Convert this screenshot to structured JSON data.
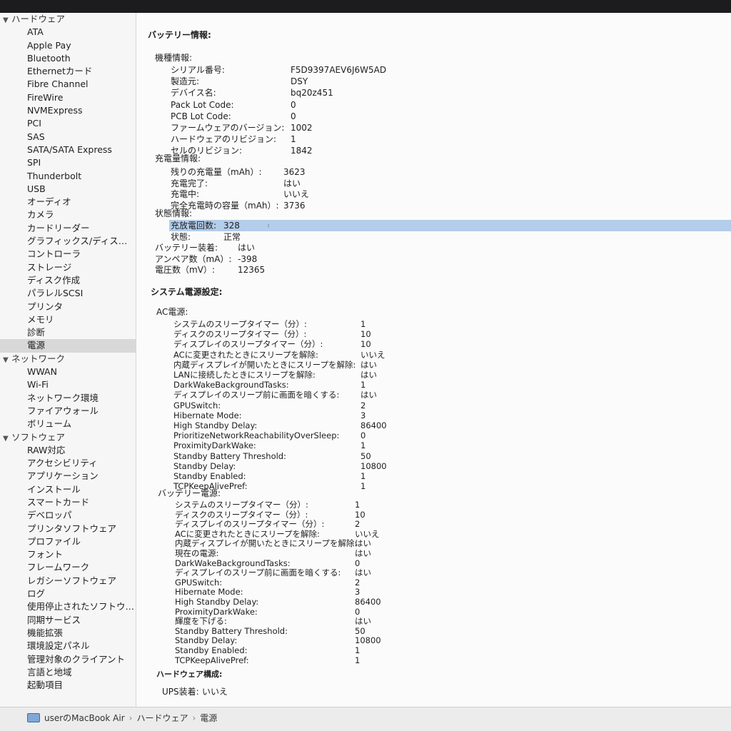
{
  "sidebar": {
    "groups": [
      {
        "label": "ハードウェア",
        "items": [
          "ATA",
          "Apple Pay",
          "Bluetooth",
          "Ethernetカード",
          "Fibre Channel",
          "FireWire",
          "NVMExpress",
          "PCI",
          "SAS",
          "SATA/SATA Express",
          "SPI",
          "Thunderbolt",
          "USB",
          "オーディオ",
          "カメラ",
          "カードリーダー",
          "グラフィックス/ディス…",
          "コントローラ",
          "ストレージ",
          "ディスク作成",
          "パラレルSCSI",
          "プリンタ",
          "メモリ",
          "診断",
          "電源"
        ],
        "selected": 24
      },
      {
        "label": "ネットワーク",
        "items": [
          "WWAN",
          "Wi-Fi",
          "ネットワーク環境",
          "ファイアウォール",
          "ボリューム"
        ]
      },
      {
        "label": "ソフトウェア",
        "items": [
          "RAW対応",
          "アクセシビリティ",
          "アプリケーション",
          "インストール",
          "スマートカード",
          "デベロッパ",
          "プリンタソフトウェア",
          "プロファイル",
          "フォント",
          "フレームワーク",
          "レガシーソフトウェア",
          "ログ",
          "使用停止されたソフトウ…",
          "同期サービス",
          "機能拡張",
          "環境設定パネル",
          "管理対象のクライアント",
          "言語と地域",
          "起動項目"
        ]
      }
    ]
  },
  "content": {
    "battery_title": "バッテリー情報:",
    "model_title": "機種情報:",
    "model": [
      {
        "k": "シリアル番号:",
        "v": "F5D9397AEV6J6W5AD"
      },
      {
        "k": "製造元:",
        "v": "DSY"
      },
      {
        "k": "デバイス名:",
        "v": "bq20z451"
      },
      {
        "k": "Pack Lot Code:",
        "v": "0"
      },
      {
        "k": "PCB Lot Code:",
        "v": "0"
      },
      {
        "k": "ファームウェアのバージョン:",
        "v": "1002"
      },
      {
        "k": "ハードウェアのリビジョン:",
        "v": "1"
      },
      {
        "k": "セルのリビジョン:",
        "v": "1842"
      }
    ],
    "charge_title": "充電量情報:",
    "charge": [
      {
        "k": "残りの充電量（mAh）:",
        "v": "3623"
      },
      {
        "k": "充電完了:",
        "v": "はい"
      },
      {
        "k": "充電中:",
        "v": "いいえ"
      },
      {
        "k": "完全充電時の容量（mAh）:",
        "v": "3736"
      }
    ],
    "status_title": "状態情報:",
    "status": [
      {
        "k": "充放電回数:",
        "v": "328"
      },
      {
        "k": "状態:",
        "v": "正常"
      }
    ],
    "battery_misc": [
      {
        "k": "バッテリー装着:",
        "v": "はい"
      },
      {
        "k": "アンペア数（mA）:",
        "v": "-398"
      },
      {
        "k": "電圧数（mV）:",
        "v": "12365"
      }
    ],
    "power_title": "システム電源設定:",
    "ac_title": "AC電源:",
    "ac": [
      {
        "k": "システムのスリープタイマー（分）:",
        "v": "1"
      },
      {
        "k": "ディスクのスリープタイマー（分）:",
        "v": "10"
      },
      {
        "k": "ディスプレイのスリープタイマー（分）:",
        "v": "10"
      },
      {
        "k": "ACに変更されたときにスリープを解除:",
        "v": "いいえ"
      },
      {
        "k": "内蔵ディスプレイが開いたときにスリープを解除:",
        "v": "はい"
      },
      {
        "k": "LANに接続したときにスリープを解除:",
        "v": "はい"
      },
      {
        "k": "DarkWakeBackgroundTasks:",
        "v": "1"
      },
      {
        "k": "ディスプレイのスリープ前に画面を暗くする:",
        "v": "はい"
      },
      {
        "k": "GPUSwitch:",
        "v": "2"
      },
      {
        "k": "Hibernate Mode:",
        "v": "3"
      },
      {
        "k": "High Standby Delay:",
        "v": "86400"
      },
      {
        "k": "PrioritizeNetworkReachabilityOverSleep:",
        "v": "0"
      },
      {
        "k": "ProximityDarkWake:",
        "v": "1"
      },
      {
        "k": "Standby Battery Threshold:",
        "v": "50"
      },
      {
        "k": "Standby Delay:",
        "v": "10800"
      },
      {
        "k": "Standby Enabled:",
        "v": "1"
      },
      {
        "k": "TCPKeepAlivePref:",
        "v": "1"
      }
    ],
    "bat_power_title": "バッテリー電源:",
    "bat_power": [
      {
        "k": "システムのスリープタイマー（分）:",
        "v": "1"
      },
      {
        "k": "ディスクのスリープタイマー（分）:",
        "v": "10"
      },
      {
        "k": "ディスプレイのスリープタイマー（分）:",
        "v": "2"
      },
      {
        "k": "ACに変更されたときにスリープを解除:",
        "v": "いいえ"
      },
      {
        "k": "内蔵ディスプレイが開いたときにスリープを解除:",
        "v": "はい"
      },
      {
        "k": "現在の電源:",
        "v": "はい"
      },
      {
        "k": "DarkWakeBackgroundTasks:",
        "v": "0"
      },
      {
        "k": "ディスプレイのスリープ前に画面を暗くする:",
        "v": "はい"
      },
      {
        "k": "GPUSwitch:",
        "v": "2"
      },
      {
        "k": "Hibernate Mode:",
        "v": "3"
      },
      {
        "k": "High Standby Delay:",
        "v": "86400"
      },
      {
        "k": "ProximityDarkWake:",
        "v": "0"
      },
      {
        "k": "輝度を下げる:",
        "v": "はい"
      },
      {
        "k": "Standby Battery Threshold:",
        "v": "50"
      },
      {
        "k": "Standby Delay:",
        "v": "10800"
      },
      {
        "k": "Standby Enabled:",
        "v": "1"
      },
      {
        "k": "TCPKeepAlivePref:",
        "v": "1"
      }
    ],
    "hw_title": "ハードウェア構成:",
    "ups": {
      "k": "UPS装着:",
      "v": "いいえ"
    }
  },
  "statusbar": {
    "crumbs": [
      "userのMacBook Air",
      "ハードウェア",
      "電源"
    ],
    "separator": "›"
  }
}
